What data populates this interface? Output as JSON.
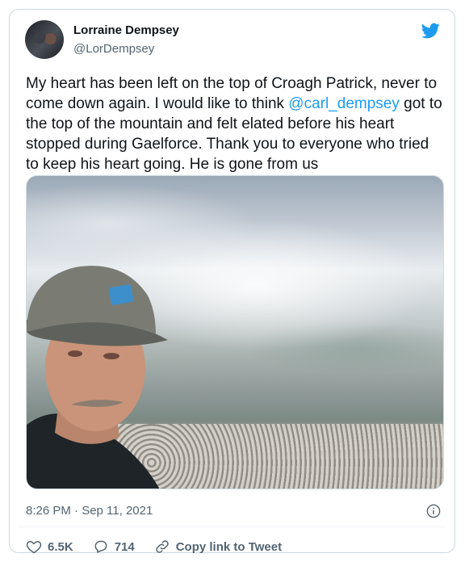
{
  "author": {
    "name": "Lorraine Dempsey",
    "handle": "@LorDempsey"
  },
  "tweet": {
    "text_1": "My heart has been left on the top of Croagh Patrick, never to come down again. I would like to think ",
    "mention": "@carl_dempsey",
    "text_2": " got to the top of the mountain and felt elated before his heart stopped during Gaelforce. Thank you to everyone who tried to keep his heart going. He is gone from us",
    "timestamp": "8:26 PM · Sep 11, 2021"
  },
  "actions": {
    "likes": "6.5K",
    "replies": "714",
    "copy_link": "Copy link to Tweet"
  },
  "icons": {
    "brand": "twitter-bird-icon",
    "info": "info-icon",
    "like": "heart-icon",
    "reply": "reply-icon",
    "link": "link-icon"
  },
  "colors": {
    "brand": "#1d9bf0",
    "like": "#f91880",
    "secondary_text": "#536471"
  }
}
